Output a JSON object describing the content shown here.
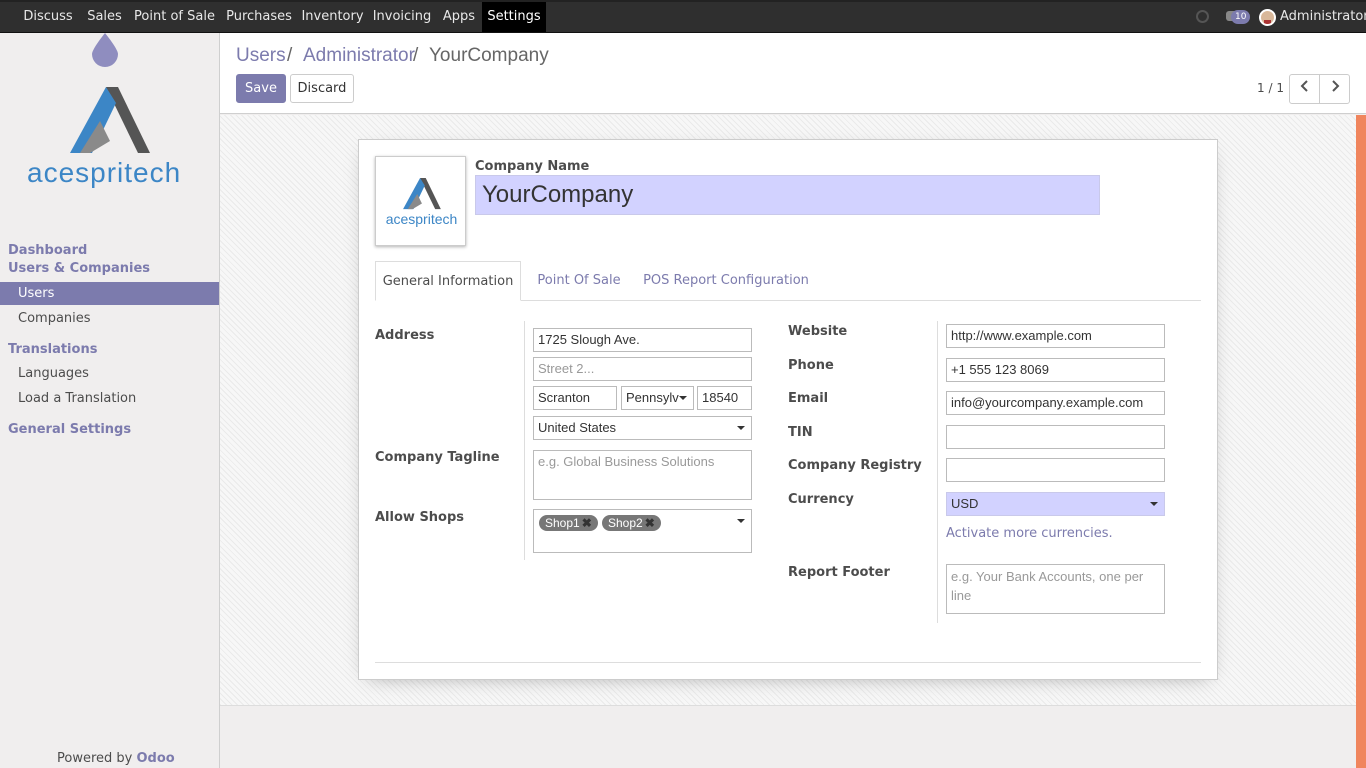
{
  "topbar": {
    "menu": [
      "Discuss",
      "Sales",
      "Point of Sale",
      "Purchases",
      "Inventory",
      "Invoicing",
      "Apps",
      "Settings"
    ],
    "active_menu": "Settings",
    "notification_count": "10",
    "user": "Administrator"
  },
  "sidebar": {
    "logo_text": "acespritech",
    "sections": {
      "dashboard": "Dashboard",
      "users_companies": "Users & Companies",
      "users": "Users",
      "companies": "Companies",
      "translations": "Translations",
      "languages": "Languages",
      "load_translation": "Load a Translation",
      "general_settings": "General Settings"
    },
    "powered_by": "Powered by",
    "powered_brand": "Odoo"
  },
  "breadcrumb": {
    "items": [
      "Users",
      "Administrator"
    ],
    "separator": "/",
    "current": "YourCompany"
  },
  "buttons": {
    "save": "Save",
    "discard": "Discard"
  },
  "pager": {
    "value": "1 / 1"
  },
  "form": {
    "logo_text": "acespritech",
    "company_name_label": "Company Name",
    "company_name": "YourCompany",
    "tabs": [
      "General Information",
      "Point Of Sale",
      "POS Report Configuration"
    ],
    "active_tab": "General Information",
    "address_label": "Address",
    "street": "1725 Slough Ave.",
    "street2_placeholder": "Street 2...",
    "city": "Scranton",
    "state": "Pennsylv",
    "zip": "18540",
    "country": "United States",
    "tagline_label": "Company Tagline",
    "tagline_placeholder": "e.g. Global Business Solutions",
    "shops_label": "Allow Shops",
    "shops": [
      "Shop1",
      "Shop2"
    ],
    "website_label": "Website",
    "website": "http://www.example.com",
    "phone_label": "Phone",
    "phone": "+1 555 123 8069",
    "email_label": "Email",
    "email": "info@yourcompany.example.com",
    "tin_label": "TIN",
    "tin": "",
    "registry_label": "Company Registry",
    "registry": "",
    "currency_label": "Currency",
    "currency": "USD",
    "activate_currencies": "Activate more currencies.",
    "footer_label": "Report Footer",
    "footer_placeholder": "e.g. Your Bank Accounts, one per line"
  },
  "colors": {
    "accent": "#7c7bad",
    "topbar": "#2f2f2f",
    "required_field": "#d2d2ff",
    "scroll_accent": "#f0855d"
  }
}
